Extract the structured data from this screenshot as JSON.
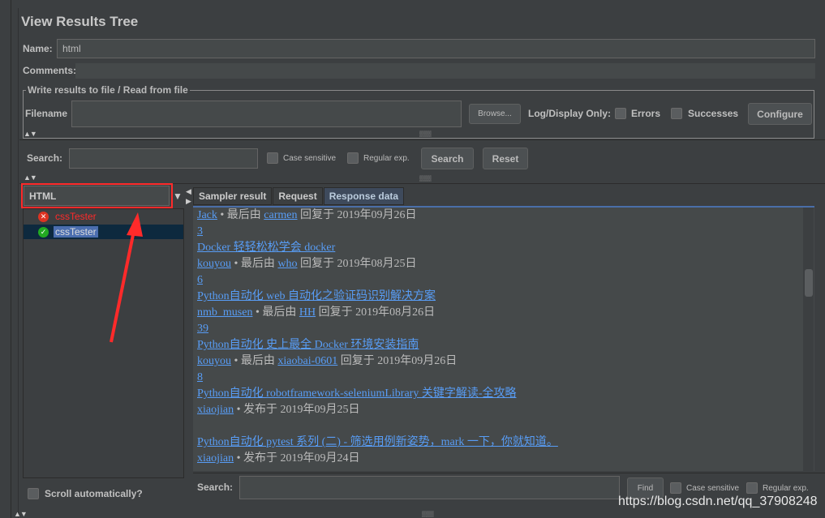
{
  "title": "View Results Tree",
  "name": {
    "label": "Name:",
    "value": "html"
  },
  "comments": {
    "label": "Comments:",
    "value": ""
  },
  "file": {
    "legend": "Write results to file / Read from file",
    "filename_label": "Filename",
    "filename_value": "",
    "browse": "Browse...",
    "log_only": "Log/Display Only:",
    "errors": "Errors",
    "successes": "Successes",
    "configure": "Configure"
  },
  "search": {
    "label": "Search:",
    "value": "",
    "case_sensitive": "Case sensitive",
    "regular_exp": "Regular exp.",
    "search_btn": "Search",
    "reset_btn": "Reset"
  },
  "renderer": {
    "selected": "HTML"
  },
  "tree": [
    {
      "label": "cssTester",
      "status": "error"
    },
    {
      "label": "cssTester",
      "status": "success",
      "selected": true
    }
  ],
  "scroll_auto": "Scroll automatically?",
  "tabs": [
    {
      "label": "Sampler result"
    },
    {
      "label": "Request"
    },
    {
      "label": "Response data",
      "active": true
    }
  ],
  "response_lines": [
    [
      {
        "t": "Jack",
        "link": true
      },
      {
        "t": " • 最后由 "
      },
      {
        "t": "carmen",
        "link": true
      },
      {
        "t": " 回复于 2019年09月26日"
      }
    ],
    [
      {
        "t": "3",
        "link": true
      }
    ],
    [
      {
        "t": "Docker 轻轻松松学会 docker ",
        "link": true
      }
    ],
    [
      {
        "t": "kouyou",
        "link": true
      },
      {
        "t": " • 最后由 "
      },
      {
        "t": "who",
        "link": true
      },
      {
        "t": " 回复于 2019年08月25日"
      }
    ],
    [
      {
        "t": "6",
        "link": true
      }
    ],
    [
      {
        "t": "Python自动化 web 自动化之验证码识别解决方案 ",
        "link": true
      }
    ],
    [
      {
        "t": "nmb_musen",
        "link": true
      },
      {
        "t": " • 最后由 "
      },
      {
        "t": "HH",
        "link": true
      },
      {
        "t": " 回复于 2019年08月26日"
      }
    ],
    [
      {
        "t": "39",
        "link": true
      }
    ],
    [
      {
        "t": "Python自动化 史上最全 Docker 环境安装指南 ",
        "link": true
      }
    ],
    [
      {
        "t": "kouyou",
        "link": true
      },
      {
        "t": " • 最后由 "
      },
      {
        "t": "xiaobai-0601",
        "link": true
      },
      {
        "t": " 回复于 2019年09月26日"
      }
    ],
    [
      {
        "t": "8",
        "link": true
      }
    ],
    [
      {
        "t": "Python自动化 robotframework-seleniumLibrary 关键字解读-全攻略 ",
        "link": true
      }
    ],
    [
      {
        "t": "xiaojian",
        "link": true
      },
      {
        "t": " • 发布于 2019年09月25日"
      }
    ],
    [],
    [
      {
        "t": "Python自动化 pytest 系列 (二) - 筛选用例新姿势，mark 一下，你就知道。 ",
        "link": true
      }
    ],
    [
      {
        "t": "xiaojian",
        "link": true
      },
      {
        "t": " • 发布于 2019年09月24日"
      }
    ]
  ],
  "find": {
    "label": "Search:",
    "value": "",
    "find_btn": "Find",
    "case_sensitive": "Case sensitive",
    "regular_exp": "Regular exp."
  },
  "watermark": "https://blog.csdn.net/qq_37908248",
  "colors": {
    "background": "#3c3f41",
    "link": "#589df6",
    "highlight": "#ff2a2a",
    "selection": "#0d293e"
  }
}
